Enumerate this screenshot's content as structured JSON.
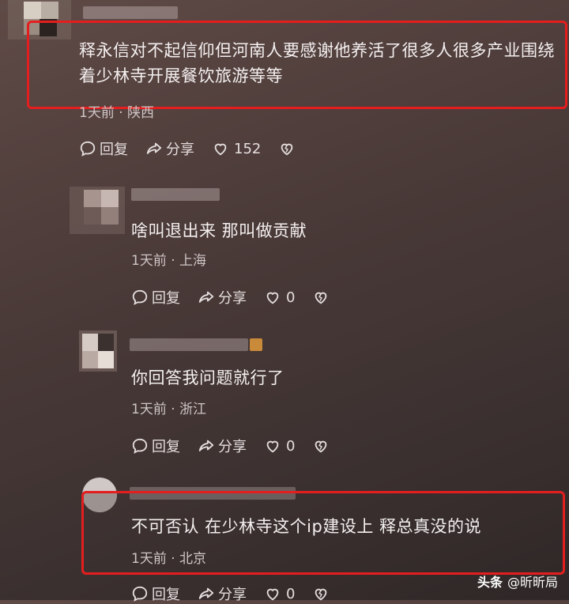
{
  "comments": [
    {
      "text": "释永信对不起信仰但河南人要感谢他养活了很多人很多产业围绕着少林寺开展餐饮旅游等等",
      "meta": "1天前 · 陕西",
      "reply_label": "回复",
      "share_label": "分享",
      "likes": "152"
    },
    {
      "text": "啥叫退出来 那叫做贡献",
      "meta": "1天前 · 上海",
      "reply_label": "回复",
      "share_label": "分享",
      "likes": "0"
    },
    {
      "text": "你回答我问题就行了",
      "meta": "1天前 · 浙江",
      "reply_label": "回复",
      "share_label": "分享",
      "likes": "0"
    },
    {
      "text": "不可否认 在少林寺这个ip建设上 释总真没的说",
      "meta": "1天前 · 北京",
      "reply_label": "回复",
      "share_label": "分享",
      "likes": "0"
    }
  ],
  "watermark": {
    "brand": "头条",
    "handle": "@昕昕局"
  },
  "colors": {
    "highlight": "#e41e1e",
    "text": "#f4f0f0",
    "meta": "#cfc6c6"
  }
}
